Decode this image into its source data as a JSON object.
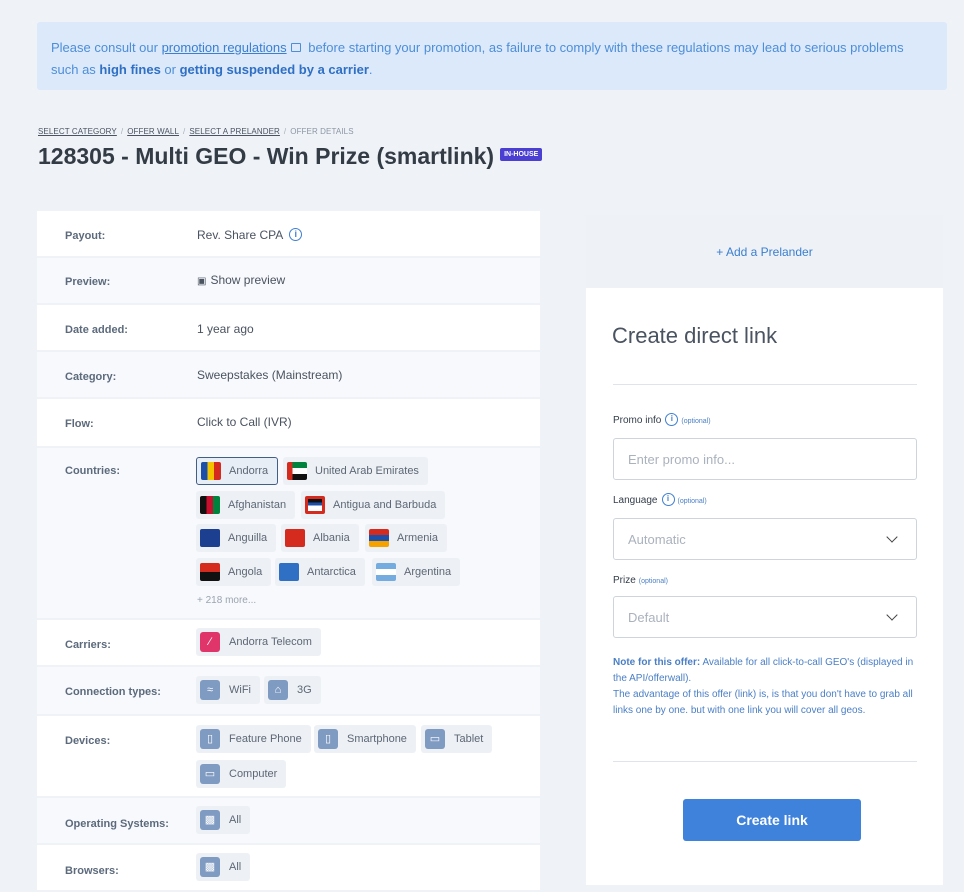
{
  "notice": {
    "prefix": "Please consult our ",
    "link": "promotion regulations",
    "mid": " before starting your promotion, as failure to comply with these regulations may lead to serious problems such as ",
    "fines": "high fines",
    "or": " or ",
    "suspend": "getting suspended by a carrier",
    "end": "."
  },
  "breadcrumb": [
    "SELECT CATEGORY",
    "OFFER WALL",
    "SELECT A PRELANDER",
    "OFFER DETAILS"
  ],
  "title": "128305 - Multi GEO - Win Prize (smartlink)",
  "badge": "IN-HOUSE",
  "rows": {
    "payout": {
      "label": "Payout:",
      "value": "Rev. Share CPA"
    },
    "preview": {
      "label": "Preview:",
      "value": "Show preview"
    },
    "date": {
      "label": "Date added:",
      "value": "1 year ago"
    },
    "category": {
      "label": "Category:",
      "value": "Sweepstakes (Mainstream)"
    },
    "flow": {
      "label": "Flow:",
      "value": "Click to Call (IVR)"
    },
    "countries": {
      "label": "Countries:",
      "more": "+ 218 more..."
    },
    "carriers": {
      "label": "Carriers:"
    },
    "connection": {
      "label": "Connection types:"
    },
    "devices": {
      "label": "Devices:"
    },
    "os": {
      "label": "Operating Systems:"
    },
    "browsers": {
      "label": "Browsers:"
    }
  },
  "countries": [
    "Andorra",
    "United Arab Emirates",
    "Afghanistan",
    "Antigua and Barbuda",
    "Anguilla",
    "Albania",
    "Armenia",
    "Angola",
    "Antarctica",
    "Argentina"
  ],
  "carriers": [
    "Andorra Telecom"
  ],
  "connection_types": [
    "WiFi",
    "3G"
  ],
  "devices": [
    "Feature Phone",
    "Smartphone",
    "Tablet",
    "Computer"
  ],
  "operating_systems": [
    "All"
  ],
  "browsers": [
    "All"
  ],
  "panel": {
    "add_prelander": "+ Add a Prelander",
    "heading": "Create direct link",
    "promo_label": "Promo info",
    "promo_placeholder": "Enter promo info...",
    "language_label": "Language",
    "language_value": "Automatic",
    "prize_label": "Prize",
    "prize_value": "Default",
    "optional": "(optional)",
    "note_bold": "Note for this offer:",
    "note_text": " Available for all click-to-call GEO's (displayed in the API/offerwall).",
    "note_text2": "The advantage of this offer (link) is, is that you don't have to grab all links one by one. but with one link you will cover all geos.",
    "button": "Create link"
  }
}
